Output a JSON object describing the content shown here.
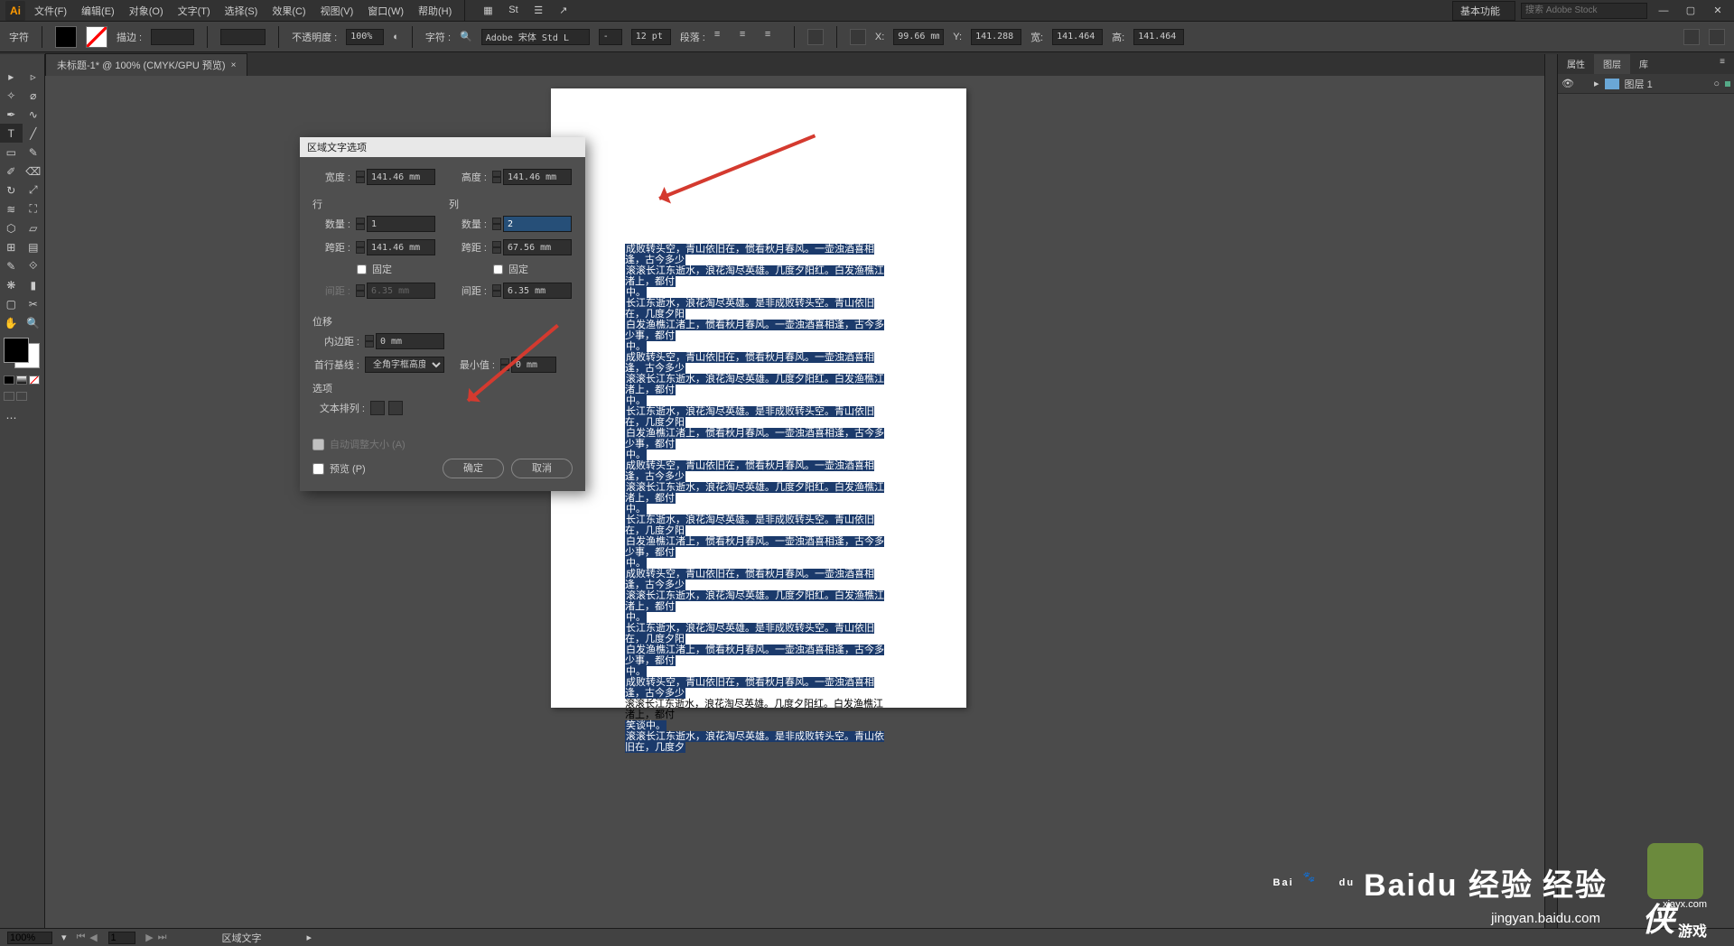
{
  "app": {
    "logo": "Ai"
  },
  "menu": [
    "文件(F)",
    "编辑(E)",
    "对象(O)",
    "文字(T)",
    "选择(S)",
    "效果(C)",
    "视图(V)",
    "窗口(W)",
    "帮助(H)"
  ],
  "topright": {
    "workspace": "基本功能",
    "search_placeholder": "搜索 Adobe Stock"
  },
  "ctrl": {
    "charlabel": "字符",
    "stroke_label": "描边 :",
    "stroke_w": "",
    "pt_dd": "",
    "opacity_label": "不透明度 :",
    "opacity": "100%",
    "char_label2": "字符 :",
    "font": "Adobe 宋体 Std L",
    "weight": "-",
    "size": "12 pt",
    "para_label": "段落 :",
    "x_label": "X:",
    "x": "99.66 mm",
    "y_label": "Y:",
    "y": "141.288 m",
    "w_label": "宽:",
    "w": "141.464 m",
    "h_label": "高:",
    "h": "141.464 m"
  },
  "tab": {
    "title": "未标题-1* @ 100% (CMYK/GPU 预览)"
  },
  "dialog": {
    "title": "区域文字选项",
    "width_label": "宽度 :",
    "width": "141.46 mm",
    "height_label": "高度 :",
    "height": "141.46 mm",
    "rows_section": "行",
    "cols_section": "列",
    "count_label": "数量 :",
    "rows_count": "1",
    "cols_count": "2",
    "span_label": "跨距 :",
    "rows_span": "141.46 mm",
    "cols_span": "67.56 mm",
    "fixed": "固定",
    "gutter_label": "间距 :",
    "rows_gutter": "6.35 mm",
    "cols_gutter": "6.35 mm",
    "inset_section": "位移",
    "inset_label": "内边距 :",
    "inset": "0 mm",
    "baseline_label": "首行基线 :",
    "baseline_value": "全角字框高度",
    "min_label": "最小值 :",
    "min": "0 mm",
    "opts_section": "选项",
    "flow_label": "文本排列 :",
    "autosize": "自动调整大小 (A)",
    "preview": "预览 (P)",
    "ok": "确定",
    "cancel": "取消"
  },
  "panels": {
    "tabs": [
      "属性",
      "图层",
      "库"
    ],
    "layer": "图层 1"
  },
  "status": {
    "zoom": "100%",
    "page_input": "1",
    "sel": "区域文字"
  },
  "artboard": {
    "lines": [
      "成败转头空，青山依旧在，惯看秋月春风。一壶浊酒喜相逢，古今多少",
      "滚滚长江东逝水，浪花淘尽英雄。几度夕阳红。白发渔樵江渚上，都付",
      "中。",
      "长江东逝水，浪花淘尽英雄。是非成败转头空。青山依旧在，几度夕阳",
      "白发渔樵江渚上，惯看秋月春风。一壶浊酒喜相逢，古今多少事，都付",
      "中。",
      "成败转头空，青山依旧在，惯看秋月春风。一壶浊酒喜相逢，古今多少",
      "滚滚长江东逝水，浪花淘尽英雄。几度夕阳红。白发渔樵江渚上，都付",
      "中。",
      "长江东逝水，浪花淘尽英雄。是非成败转头空。青山依旧在，几度夕阳",
      "白发渔樵江渚上，惯看秋月春风。一壶浊酒喜相逢，古今多少事，都付",
      "中。",
      "成败转头空，青山依旧在，惯看秋月春风。一壶浊酒喜相逢，古今多少",
      "滚滚长江东逝水，浪花淘尽英雄。几度夕阳红。白发渔樵江渚上，都付",
      "中。",
      "长江东逝水，浪花淘尽英雄。是非成败转头空。青山依旧在，几度夕阳",
      "白发渔樵江渚上，惯看秋月春风。一壶浊酒喜相逢，古今多少事，都付",
      "中。",
      "成败转头空，青山依旧在，惯看秋月春风。一壶浊酒喜相逢，古今多少",
      "滚滚长江东逝水，浪花淘尽英雄。几度夕阳红。白发渔樵江渚上，都付",
      "中。",
      "长江东逝水，浪花淘尽英雄。是非成败转头空。青山依旧在，几度夕阳",
      "白发渔樵江渚上，惯看秋月春风。一壶浊酒喜相逢，古今多少事，都付",
      "中。",
      "成败转头空，青山依旧在，惯看秋月春风。一壶浊酒喜相逢，古今多少",
      "滚滚长江东逝水，浪花淘尽英雄。几度夕阳红。白发渔樵江渚上，都付",
      "笑谈中。",
      "滚滚长江东逝水，浪花淘尽英雄。是非成败转头空。青山依旧在，几度夕"
    ],
    "plain_idx": [
      25
    ]
  },
  "watermark": {
    "baidu": "Baidu 经验",
    "url": "jingyan.baidu.com",
    "xia": "xiayx.com",
    "game1": "侠",
    "game2": "游戏"
  }
}
